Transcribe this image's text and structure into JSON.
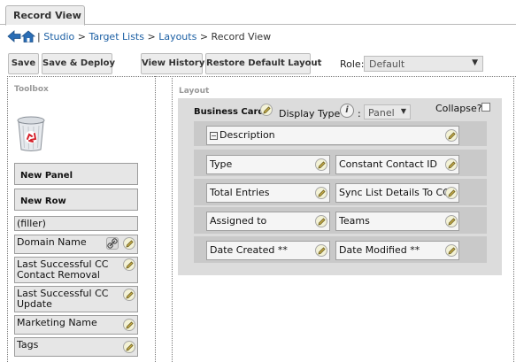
{
  "tab": {
    "label": "Record View"
  },
  "breadcrumb": {
    "separator_lead": "|",
    "items": [
      "Studio",
      "Target Lists",
      "Layouts"
    ],
    "separator": ">",
    "current": "Record View"
  },
  "toolbar": {
    "save": "Save",
    "save_deploy": "Save & Deploy",
    "view_history": "View History",
    "restore_default": "Restore Default Layout",
    "role_label": "Role:",
    "role_value": "Default"
  },
  "toolbox": {
    "title": "Toolbox",
    "items": [
      {
        "label": "New Panel",
        "kind": "panel"
      },
      {
        "label": "New Row",
        "kind": "row"
      },
      {
        "label": "(filler)"
      },
      {
        "label": "Domain Name",
        "has_link_icon": true
      },
      {
        "label": "Last Successful CC Contact Removal"
      },
      {
        "label": "Last Successful CC Update"
      },
      {
        "label": "Marketing Name"
      },
      {
        "label": "Tags"
      }
    ]
  },
  "layout": {
    "title": "Layout",
    "panel": {
      "name": "Business Card",
      "display_type_label": "Display Type",
      "info_icon_text": "i",
      "colon": ":",
      "display_type_value": "Panel",
      "collapse_label": "Collapse?",
      "collapse_checked": false,
      "rows": [
        [
          "Description"
        ],
        [
          "Type",
          "Constant Contact ID"
        ],
        [
          "Total Entries",
          "Sync List Details To CC"
        ],
        [
          "Assigned to",
          "Teams"
        ],
        [
          "Date Created **",
          "Date Modified **"
        ]
      ]
    }
  },
  "colors": {
    "link": "#1a5ea3",
    "button_bg": "#ececec",
    "layout_bg": "#dcdcdc",
    "row_bg": "#c9c9c9",
    "field_bg": "#f5f5f5"
  },
  "icons": [
    "back-arrow-icon",
    "home-icon",
    "trash-icon",
    "edit-pencil-icon",
    "link-icon",
    "info-icon",
    "chevron-down-icon"
  ]
}
